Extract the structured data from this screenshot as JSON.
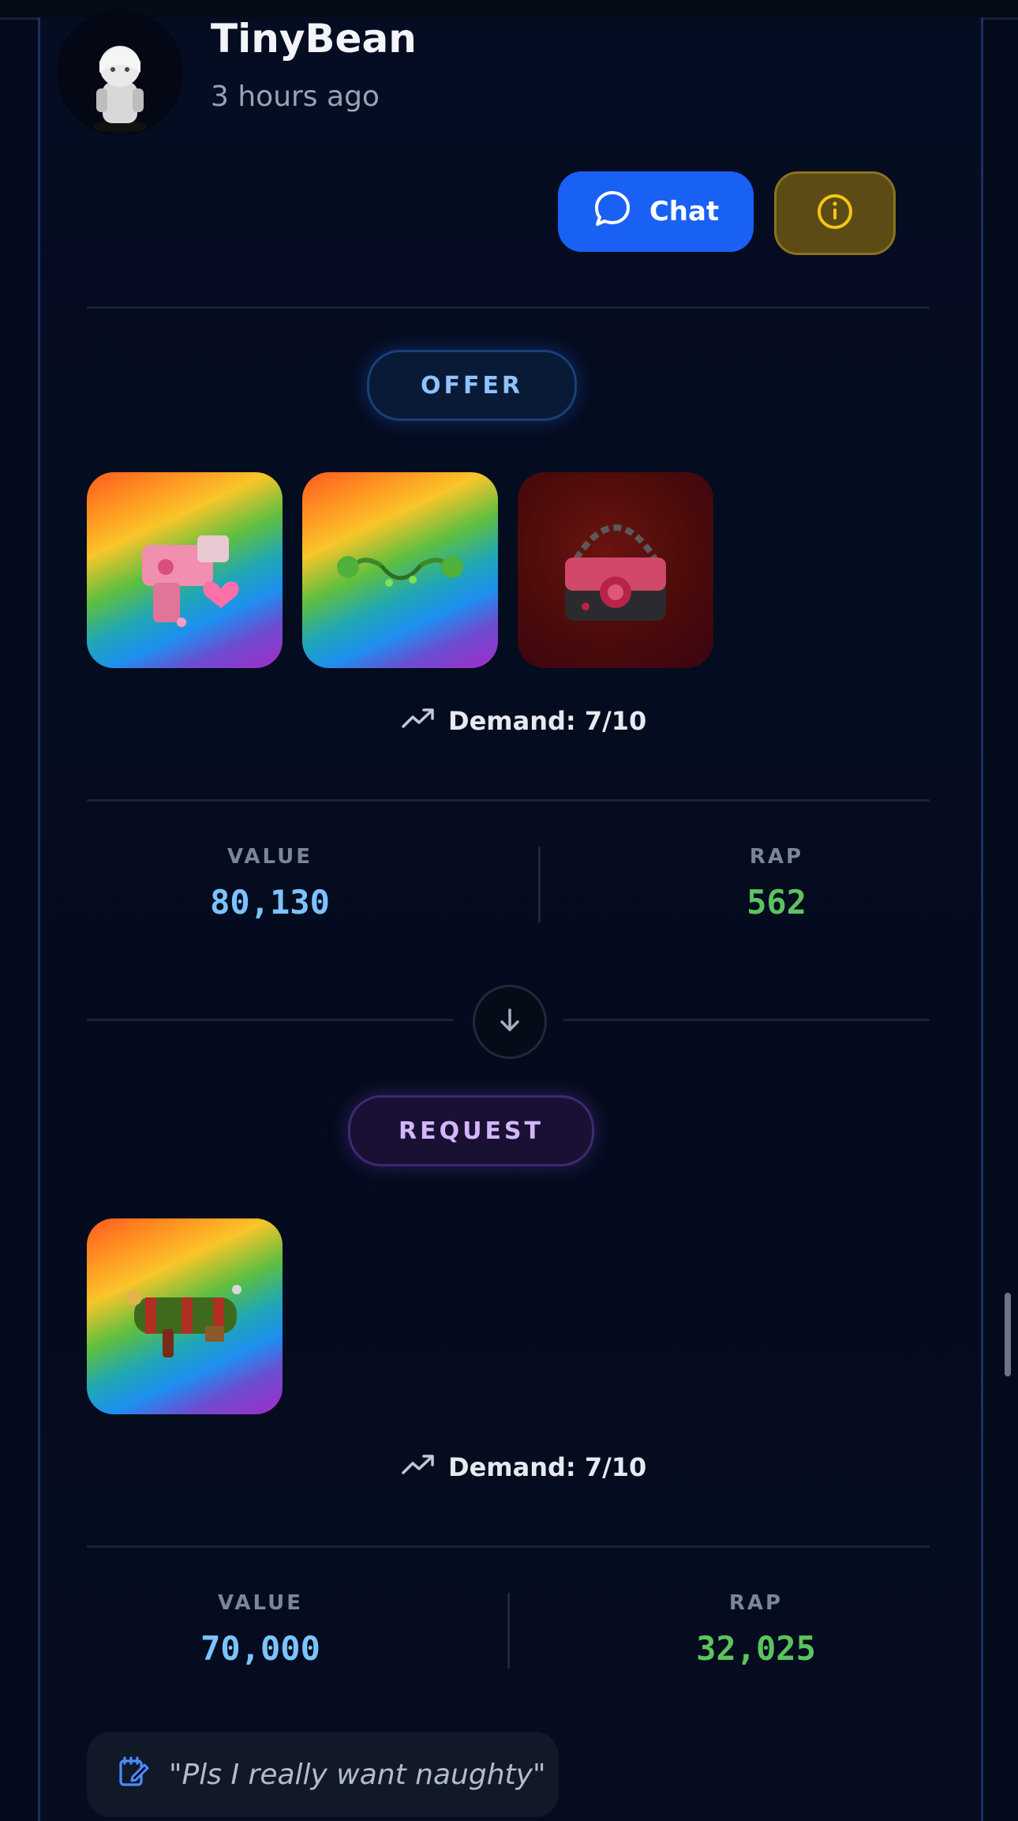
{
  "user": {
    "name": "TinyBean",
    "time_ago": "3 hours ago"
  },
  "actions": {
    "chat_label": "Chat"
  },
  "offer": {
    "label": "OFFER",
    "items": [
      "pink-heart-blaster-item",
      "green-antennae-item",
      "rose-handbag-item"
    ],
    "demand": "Demand: 7/10",
    "value_label": "VALUE",
    "value": "80,130",
    "rap_label": "RAP",
    "rap": "562"
  },
  "request": {
    "label": "REQUEST",
    "items": [
      "festive-cannon-item"
    ],
    "demand": "Demand: 7/10",
    "value_label": "VALUE",
    "value": "70,000",
    "rap_label": "RAP",
    "rap": "32,025"
  },
  "note": {
    "text": "\"Pls I really want naughty\""
  },
  "colors": {
    "chat_button": "#1960f5",
    "info_button": "#5c4b14",
    "value_blue": "#7cc3ff",
    "rap_green": "#5cc35f"
  }
}
